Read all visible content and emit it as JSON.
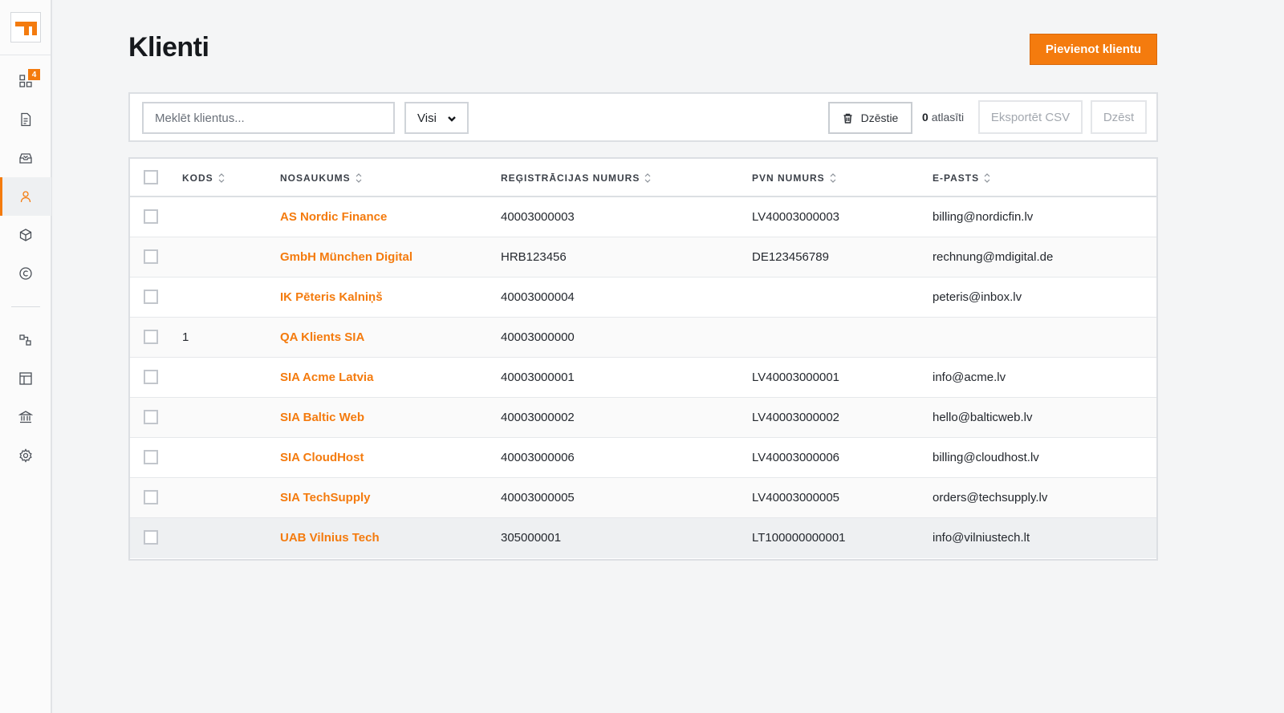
{
  "sidebar": {
    "logo": "logo-icon",
    "badge_count": "4",
    "items": [
      {
        "icon": "dashboard-icon",
        "name": "dashboard"
      },
      {
        "icon": "document-icon",
        "name": "invoices"
      },
      {
        "icon": "inbox-icon",
        "name": "inbox"
      },
      {
        "icon": "user-icon",
        "name": "clients"
      },
      {
        "icon": "box-icon",
        "name": "products"
      },
      {
        "icon": "copyright-icon",
        "name": "licenses"
      },
      {
        "icon": "shapes-icon",
        "name": "integrations"
      },
      {
        "icon": "layout-icon",
        "name": "templates"
      },
      {
        "icon": "bank-icon",
        "name": "bank"
      },
      {
        "icon": "gear-icon",
        "name": "settings"
      }
    ]
  },
  "header": {
    "title": "Klienti",
    "add_button": "Pievienot klientu"
  },
  "toolbar": {
    "search_placeholder": "Meklēt klientus...",
    "filter_value": "Visi",
    "delete_label": "Dzēstie",
    "selected_count": "0",
    "selected_label": "atlasīti",
    "export_label": "Eksportēt CSV",
    "bulk_delete_label": "Dzēst"
  },
  "table": {
    "columns": [
      "KODS",
      "NOSAUKUMS",
      "REĢISTRĀCIJAS NUMURS",
      "PVN NUMURS",
      "E-PASTS"
    ],
    "rows": [
      {
        "code": "",
        "name": "AS Nordic Finance",
        "reg": "40003000003",
        "vat": "LV40003000003",
        "email": "billing@nordicfin.lv"
      },
      {
        "code": "",
        "name": "GmbH München Digital",
        "reg": "HRB123456",
        "vat": "DE123456789",
        "email": "rechnung@mdigital.de"
      },
      {
        "code": "",
        "name": "IK Pēteris Kalniņš",
        "reg": "40003000004",
        "vat": "",
        "email": "peteris@inbox.lv"
      },
      {
        "code": "1",
        "name": "QA Klients SIA",
        "reg": "40003000000",
        "vat": "",
        "email": ""
      },
      {
        "code": "",
        "name": "SIA Acme Latvia",
        "reg": "40003000001",
        "vat": "LV40003000001",
        "email": "info@acme.lv"
      },
      {
        "code": "",
        "name": "SIA Baltic Web",
        "reg": "40003000002",
        "vat": "LV40003000002",
        "email": "hello@balticweb.lv"
      },
      {
        "code": "",
        "name": "SIA CloudHost",
        "reg": "40003000006",
        "vat": "LV40003000006",
        "email": "billing@cloudhost.lv"
      },
      {
        "code": "",
        "name": "SIA TechSupply",
        "reg": "40003000005",
        "vat": "LV40003000005",
        "email": "orders@techsupply.lv"
      },
      {
        "code": "",
        "name": "UAB Vilnius Tech",
        "reg": "305000001",
        "vat": "LT100000000001",
        "email": "info@vilniustech.lt"
      }
    ]
  },
  "colors": {
    "accent": "#f47b0e",
    "background": "#f4f5f6"
  }
}
